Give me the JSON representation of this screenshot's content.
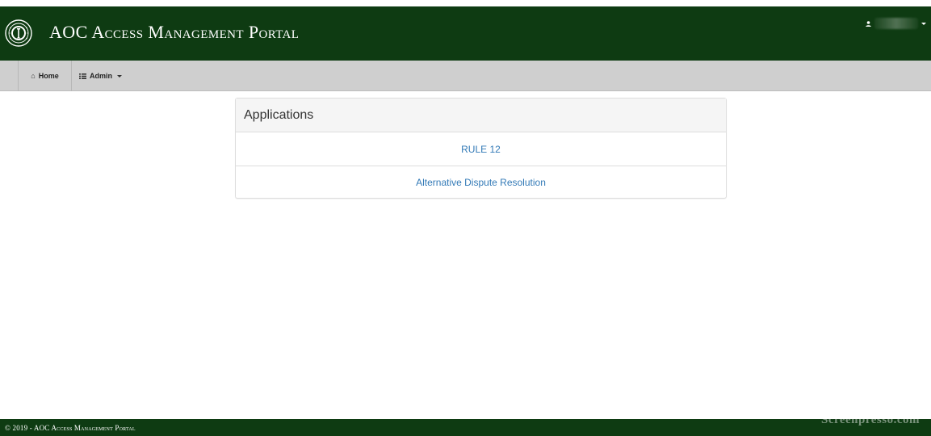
{
  "header": {
    "brand_title": "AOC Access Management Portal",
    "user": {
      "icon": "user-icon",
      "name": "user",
      "dropdown_icon": "caret-down-icon"
    }
  },
  "navbar": {
    "home": {
      "icon": "home-icon",
      "label": "Home"
    },
    "admin": {
      "icon": "list-icon",
      "label": "Admin",
      "dropdown_icon": "caret-down-icon"
    }
  },
  "applications": {
    "title": "Applications",
    "items": [
      {
        "label": "RULE 12"
      },
      {
        "label": "Alternative Dispute Resolution"
      }
    ]
  },
  "footer": {
    "text": "© 2019 - AOC Access Management Portal",
    "watermark": "Screenpresso.com"
  },
  "colors": {
    "header_green": "#0e3b12",
    "navbar_gray": "#cfcfcf",
    "link_blue": "#337ab7"
  }
}
